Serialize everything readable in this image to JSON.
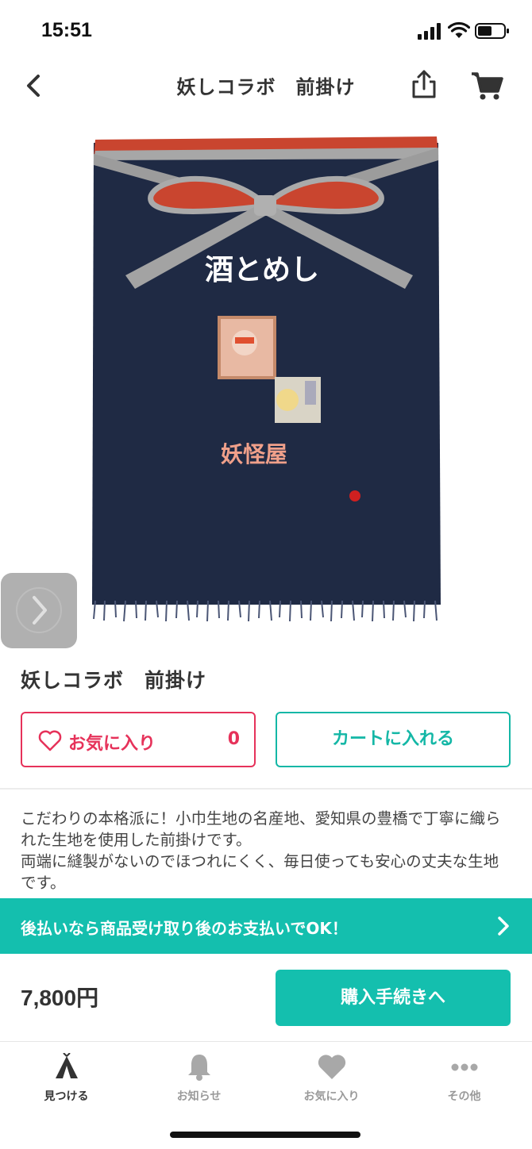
{
  "status_bar": {
    "time": "15:51"
  },
  "nav": {
    "title": "妖しコラボ　前掛け"
  },
  "image": {
    "apron_text_top": "酒とめし",
    "apron_text_bottom": "妖怪屋"
  },
  "product": {
    "title": "妖しコラボ　前掛け"
  },
  "actions": {
    "favorite_label": "お気に入り",
    "favorite_count": "0",
    "add_to_cart_label": "カートに入れる"
  },
  "description": {
    "line1": "こだわりの本格派に！小巾生地の名産地、愛知県の豊橋で丁寧に織られた生地を使用した前掛けです。",
    "line2": "両端に縫製がないのでほつれにくく、毎日使っても安心の丈夫な生地です。"
  },
  "payment_banner": {
    "text": "後払いなら商品受け取り後のお支払いでOK！"
  },
  "purchase": {
    "price": "7,800円",
    "button_label": "購入手続きへ"
  },
  "tabs": [
    {
      "label": "見つける",
      "icon": "tent-icon",
      "active": true
    },
    {
      "label": "お知らせ",
      "icon": "bell-icon",
      "active": false
    },
    {
      "label": "お気に入り",
      "icon": "heart-icon",
      "active": false
    },
    {
      "label": "その他",
      "icon": "more-dots-icon",
      "active": false
    }
  ],
  "colors": {
    "accent": "#14bfae",
    "favorite": "#e6325a",
    "apron": "#1f2a44"
  }
}
